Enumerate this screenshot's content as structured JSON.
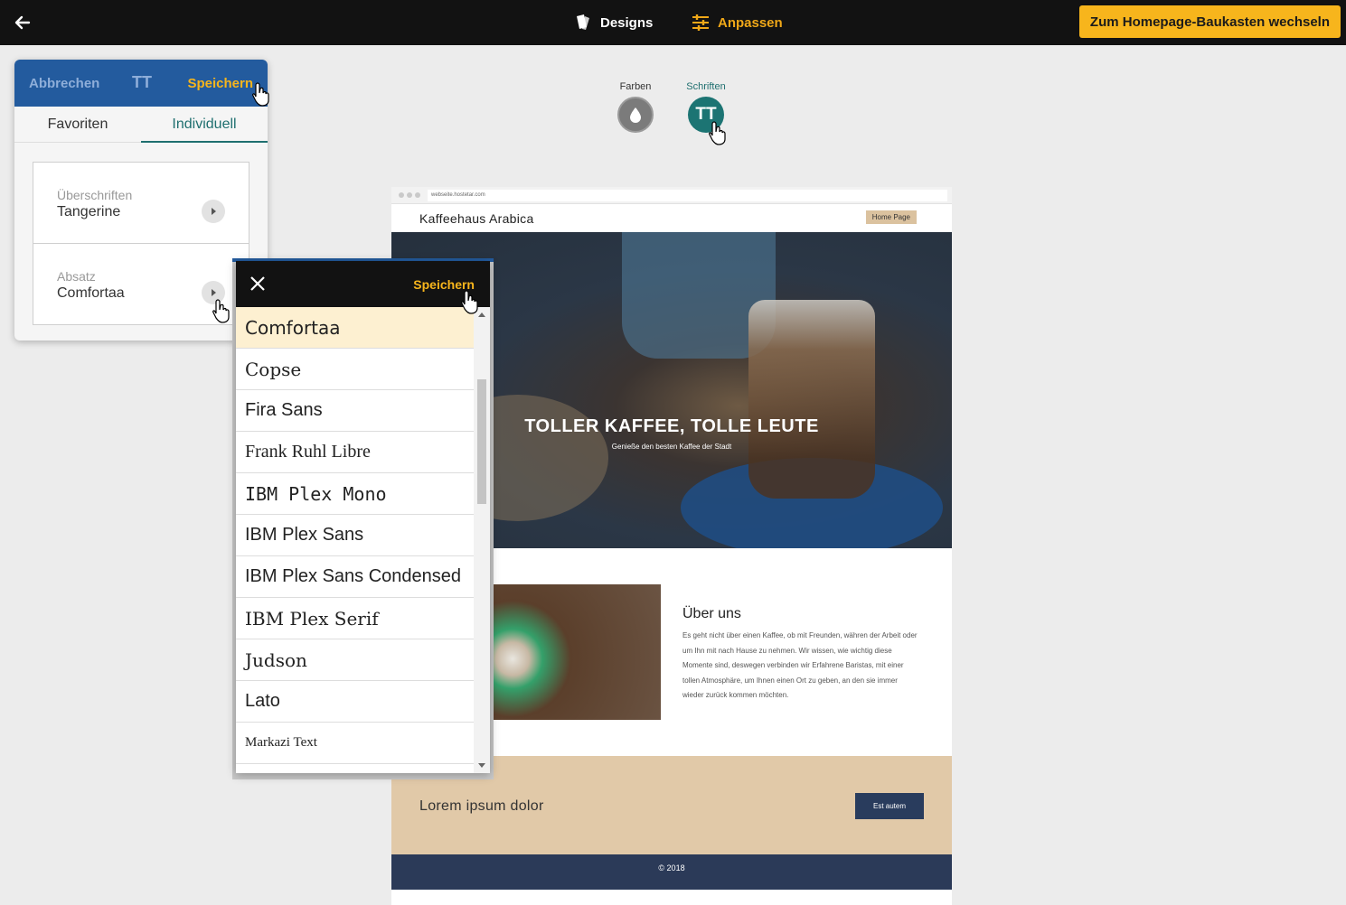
{
  "topbar": {
    "designs_label": "Designs",
    "anpassen_label": "Anpassen",
    "switch_label": "Zum Homepage-Baukasten wechseln",
    "accent": "#f7b51c"
  },
  "toggles": {
    "farben_label": "Farben",
    "schriften_label": "Schriften",
    "schriften_icon_text": "TT"
  },
  "panel": {
    "cancel_label": "Abbrechen",
    "icon_text": "TT",
    "save_label": "Speichern",
    "tabs": [
      "Favoriten",
      "Individuell"
    ],
    "rows": [
      {
        "caption": "Überschriften",
        "value": "Tangerine"
      },
      {
        "caption": "Absatz",
        "value": "Comfortaa"
      }
    ]
  },
  "dropdown": {
    "save_label": "Speichern",
    "fonts": [
      "Comfortaa",
      "Copse",
      "Fira Sans",
      "Frank Ruhl Libre",
      "IBM Plex Mono",
      "IBM Plex Sans",
      "IBM Plex Sans Condensed",
      "IBM Plex Serif",
      "Judson",
      "Lato",
      "Markazi Text"
    ],
    "selected": "Comfortaa"
  },
  "preview": {
    "url": "webseite.hostetar.com",
    "brand": "Kaffeehaus Arabica",
    "nav_home": "Home Page",
    "hero_title": "TOLLER KAFFEE, TOLLE LEUTE",
    "hero_sub": "Genieße den besten Kaffee der Stadt",
    "about_title": "Über uns",
    "about_text": "Es geht nicht über einen Kaffee, ob mit Freunden, währen der Arbeit oder um Ihn mit nach Hause zu nehmen. Wir wissen, wie wichtig diese Momente sind, deswegen verbinden wir Erfahrene Baristas, mit einer tollen Atmosphäre, um Ihnen einen Ort zu geben, an den sie immer wieder zurück kommen möchten.",
    "cta_text": "Lorem ipsum dolor",
    "cta_button": "Est autem",
    "footer": "© 2018"
  }
}
